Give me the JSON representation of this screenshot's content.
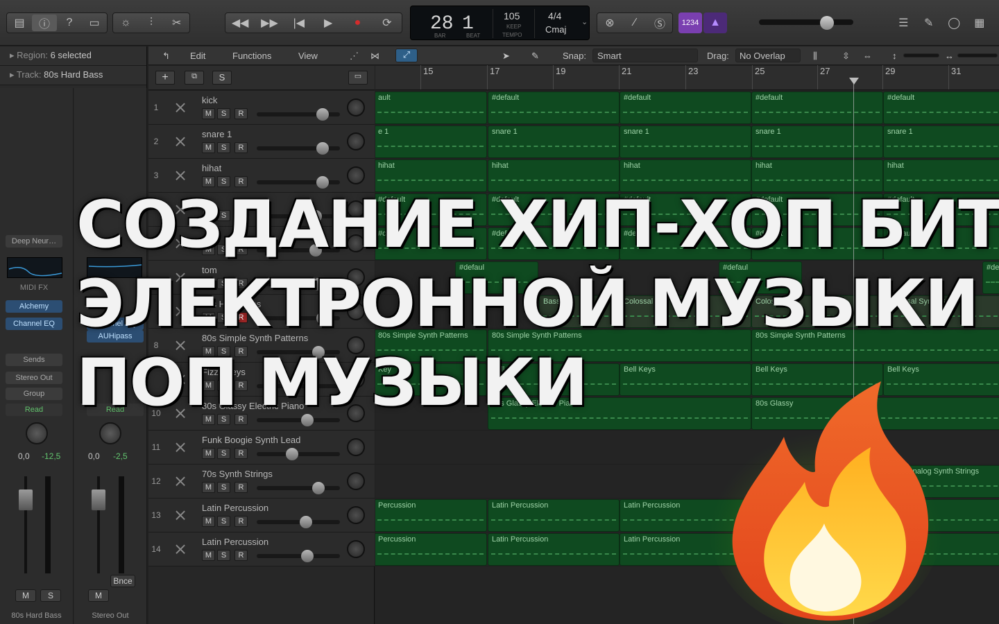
{
  "lcd": {
    "bar": "28",
    "beat": "1",
    "bar_label": "BAR",
    "beat_label": "BEAT",
    "tempo": "105",
    "tempo_mode": "KEEP",
    "tempo_label": "TEMPO",
    "time_sig": "4/4",
    "key": "Cmaj"
  },
  "count_in": "1234",
  "inspector": {
    "region_label": "Region:",
    "region_value": "6 selected",
    "track_label": "Track:",
    "track_value": "80s Hard Bass"
  },
  "strip1": {
    "plugin": "Deep Neur…",
    "midi_fx": "MIDI FX",
    "insert1": "Alchemy",
    "insert2": "Channel EQ",
    "sends": "Sends",
    "output": "Stereo Out",
    "group": "Group",
    "automation": "Read",
    "pan": "0,0",
    "level": "-12,5",
    "mute": "M",
    "solo": "S",
    "name": "80s Hard Bass"
  },
  "strip2": {
    "insert1": "Channel EQ",
    "insert2": "AUHipass",
    "automation": "Read",
    "pan": "0,0",
    "level": "-2,5",
    "bounce": "Bnce",
    "mute": "M",
    "name": "Stereo Out"
  },
  "toolbar": {
    "edit": "Edit",
    "functions": "Functions",
    "view": "View",
    "snap_label": "Snap:",
    "snap_value": "Smart",
    "drag_label": "Drag:",
    "drag_value": "No Overlap"
  },
  "add_track": "+",
  "solo_global": "S",
  "ruler": [
    "15",
    "17",
    "19",
    "21",
    "23",
    "25",
    "27",
    "29",
    "31"
  ],
  "tracks": [
    {
      "num": "1",
      "name": "kick"
    },
    {
      "num": "2",
      "name": "snare 1"
    },
    {
      "num": "3",
      "name": "hihat"
    },
    {
      "num": "",
      "name": ""
    },
    {
      "num": "6",
      "name": ""
    },
    {
      "num": "",
      "name": "tom"
    },
    {
      "num": "",
      "name": "80s Hard Bass"
    },
    {
      "num": "8",
      "name": "80s Simple Synth Patterns"
    },
    {
      "num": "",
      "name": "Fizzy Keys"
    },
    {
      "num": "10",
      "name": "80s Glassy Electric Piano"
    },
    {
      "num": "11",
      "name": "Funk Boogie Synth Lead"
    },
    {
      "num": "12",
      "name": "70s Synth Strings"
    },
    {
      "num": "13",
      "name": "Latin Percussion"
    },
    {
      "num": "14",
      "name": "Latin Percussion"
    }
  ],
  "btn": {
    "m": "M",
    "s": "S",
    "r": "R"
  },
  "regions": {
    "default": "#default",
    "default_short": "ault",
    "snare": "snare 1",
    "snare_short": "e 1",
    "hihat": "hihat",
    "default_cut": "#defaul",
    "default_tiny": "#de",
    "bass": "Colossal Synth Bass",
    "bass_a": "Bass",
    "bass_b": "Colossal Sy",
    "bass_c": "Colossal",
    "bass_d": "s",
    "synth": "80s Simple Synth Patterns",
    "bell": "Bell Keys",
    "bell_short": "Key",
    "piano": "80s Glassy Electric Piano",
    "piano_short": "80s Glassy",
    "strings": "Retro Analog Synth Strings",
    "perc": "Latin Percussion",
    "perc_short": "Percussion",
    "perc_short2": "ercussion"
  },
  "overlay": {
    "line1": "СОЗДАНИЕ ХИП-ХОП БИТОВ",
    "line2": "ЭЛЕКТРОННОЙ МУЗЫКИ И",
    "line3": "ПОП МУЗЫКИ"
  }
}
